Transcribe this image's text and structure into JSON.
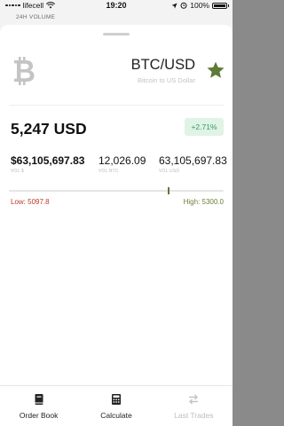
{
  "status_bar": {
    "carrier": "lifecell",
    "time": "19:20",
    "battery": "100%"
  },
  "background_hint": "24H VOLUME",
  "header": {
    "pair": "BTC/USD",
    "subtitle": "Bitcoin to US Dollar",
    "coin_icon": "bitcoin-icon",
    "favorite_icon": "star-icon"
  },
  "price": {
    "value": "5,247 USD",
    "change": "+2.71%"
  },
  "stats": [
    {
      "value": "$63,105,697.83",
      "label": "VOL $"
    },
    {
      "value": "12,026.09",
      "label": "VOL BTC"
    },
    {
      "value": "63,105,697.83",
      "label": "VOL USD"
    }
  ],
  "range": {
    "low_label": "Low: 5097.8",
    "high_label": "High: 5300.0",
    "low": 5097.8,
    "high": 5300.0,
    "current": 5247
  },
  "tabs": [
    {
      "label": "Order Book",
      "icon": "book-icon",
      "enabled": true
    },
    {
      "label": "Calculate",
      "icon": "calculator-icon",
      "enabled": true
    },
    {
      "label": "Last Trades",
      "icon": "swap-arrows-icon",
      "enabled": false
    }
  ],
  "colors": {
    "positive": "#3a9a63",
    "positive_bg": "#dff3e6",
    "low": "#c0392b",
    "high": "#6b7f3a",
    "star": "#5d7a36"
  }
}
